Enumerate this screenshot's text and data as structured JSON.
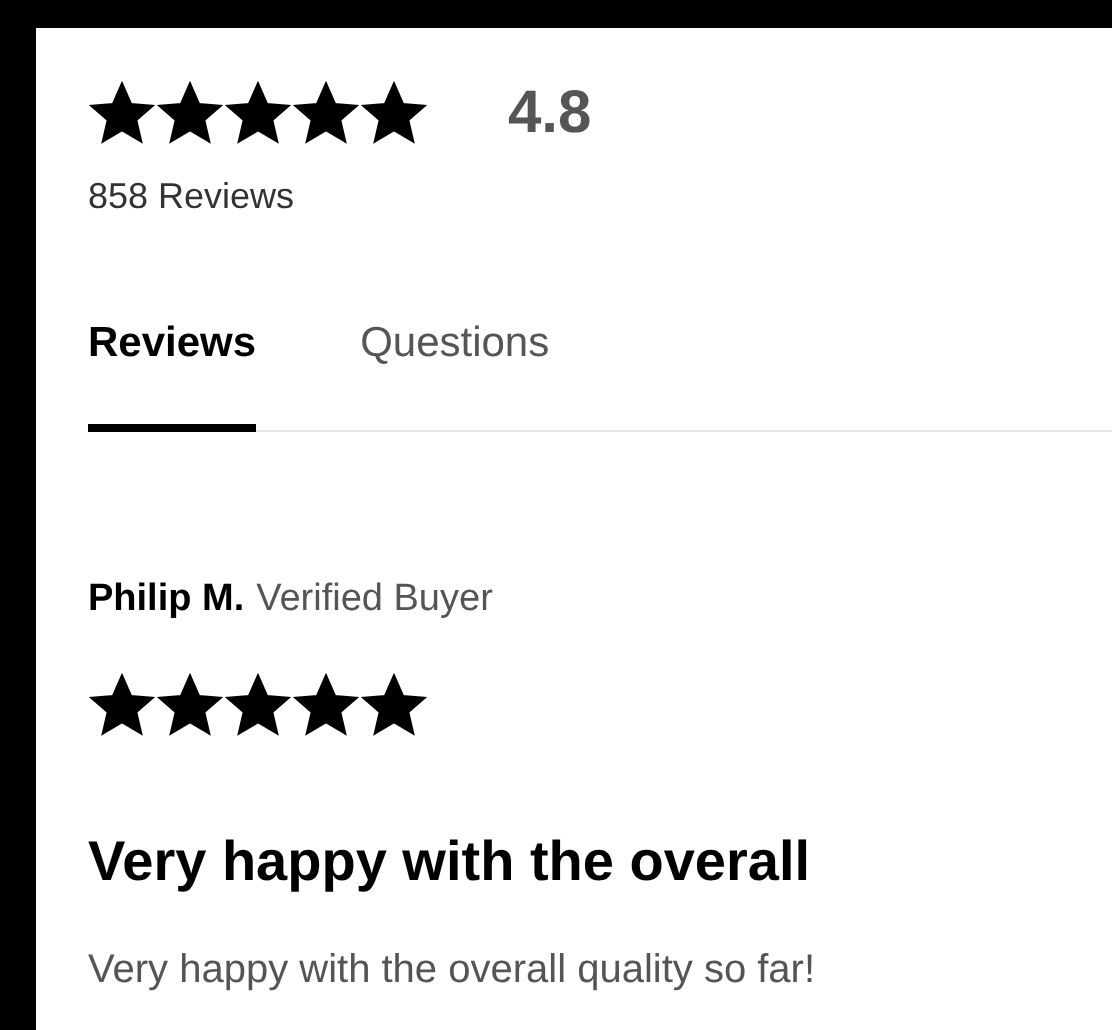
{
  "summary": {
    "stars": 5,
    "rating": "4.8",
    "count": "858 Reviews"
  },
  "tabs": [
    {
      "label": "Reviews",
      "selected": true
    },
    {
      "label": "Questions",
      "selected": false
    }
  ],
  "review": {
    "author": "Philip M.",
    "badge": "Verified Buyer",
    "stars": 5,
    "title": "Very happy with the overall",
    "body": "Very happy with the overall quality so far!"
  }
}
